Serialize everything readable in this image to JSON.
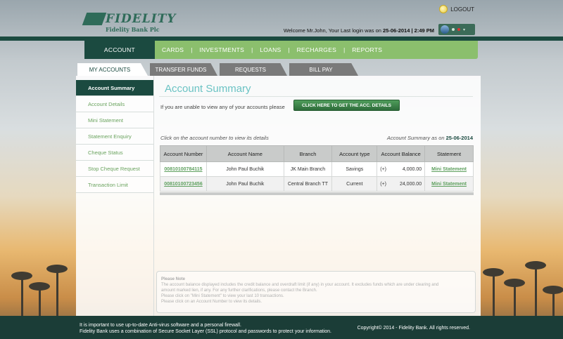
{
  "header": {
    "logo_text": "FIDELITY",
    "logo_sub": "Fidelity Bank Plc",
    "logout_label": "LOGOUT",
    "welcome_prefix": "Welcome Mr.John, Your Last login was on ",
    "last_login": "25-06-2014 | 2:49 PM"
  },
  "main_nav": {
    "items": [
      "ACCOUNT",
      "CARDS",
      "INVESTMENTS",
      "LOANS",
      "RECHARGES",
      "REPORTS"
    ]
  },
  "sub_nav": {
    "tabs": [
      "MY ACCOUNTS",
      "TRANSFER FUNDS",
      "REQUESTS",
      "BILL PAY"
    ]
  },
  "sidebar": {
    "items": [
      "Account Summary",
      "Account Details",
      "Mini Statement",
      "Statement Enquiry",
      "Cheque Status",
      "Stop Cheque Request",
      "Transaction Limit"
    ]
  },
  "main": {
    "title": "Account Summary",
    "info_text": "If you are unable to view any of your accounts please",
    "get_details_label": "CLICK HERE TO GET THE ACC. DETAILS",
    "hint": "Click on the account number to view its details",
    "asof_prefix": "Account Summary as on ",
    "asof_date": "25-06-2014",
    "table": {
      "headers": [
        "Account Number",
        "Account Name",
        "Branch",
        "Account type",
        "Account Balance",
        "Statement"
      ],
      "rows": [
        {
          "account_number": "00810100784115",
          "account_name": "John Paul Buchik",
          "branch": "JK Main Branch",
          "type": "Savings",
          "sign": "(+)",
          "balance": "4,000.00",
          "statement": "Mini Statement"
        },
        {
          "account_number": "00810100723456",
          "account_name": "John Paul Buchik",
          "branch": "Central Branch TT",
          "type": "Current",
          "sign": "(+)",
          "balance": "24,000.00",
          "statement": "Mini Statement"
        }
      ]
    }
  },
  "note": {
    "title": "Please Note",
    "lines": [
      "The account balance displayed includes the credit balance and overdraft limit (if any) in your account. It excludes funds which are under clearing and",
      "amount marked lien, if any. For any further clarifications, please contact the Branch.",
      "Please click on \"Mini Statement\" to view your last 10 transactions.",
      "Please click on an Account Number to view its details."
    ]
  },
  "footer": {
    "line1": "It is important to use up-to-date Anti-virus software and a personal firewall.",
    "line2": "Fidelity Bank uses a combination of Secure Socket Layer (SSL) protocol and passwords to protect your information.",
    "copyright": "Copyright© 2014 - Fidelity Bank. All rights reserved."
  },
  "colors": {
    "brand_dark": "#1b4a40",
    "nav_green": "#8bbf6d",
    "link_green": "#5fa05f",
    "title_teal": "#6bc3c4"
  }
}
